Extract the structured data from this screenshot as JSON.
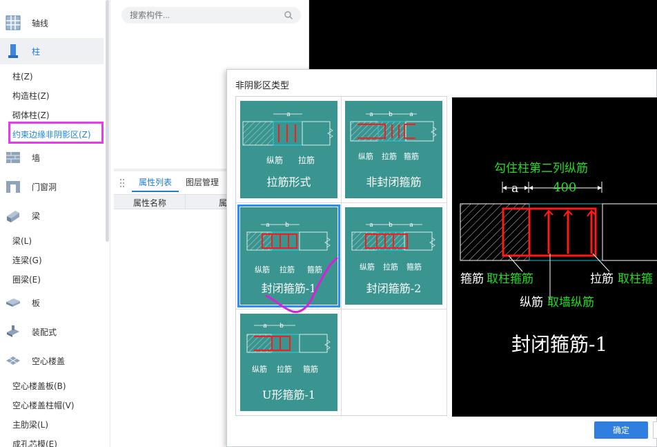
{
  "sidebar": {
    "categories": [
      {
        "label": "轴线",
        "icon": "grid-axis-icon"
      },
      {
        "label": "柱",
        "icon": "column-icon"
      },
      {
        "label": "墙",
        "icon": "wall-icon"
      },
      {
        "label": "门窗洞",
        "icon": "door-window-icon"
      },
      {
        "label": "梁",
        "icon": "beam-icon"
      },
      {
        "label": "板",
        "icon": "slab-icon"
      },
      {
        "label": "装配式",
        "icon": "prefab-icon"
      },
      {
        "label": "空心楼盖",
        "icon": "hollow-floor-icon"
      }
    ],
    "column_items": [
      "柱(Z)",
      "构造柱(Z)",
      "砌体柱(Z)",
      "约束边缘非阴影区(Z)"
    ],
    "beam_items": [
      "梁(L)",
      "连梁(G)",
      "圈梁(E)"
    ],
    "hollow_items": [
      "空心楼盖板(B)",
      "空心楼盖柱帽(V)",
      "主肋梁(L)",
      "成孔芯模(E)"
    ]
  },
  "search": {
    "placeholder": "搜索构件..."
  },
  "tabs": [
    "属性列表",
    "图层管理"
  ],
  "prop_table": {
    "headers": [
      "属性名称",
      "属"
    ]
  },
  "dialog": {
    "title": "非阴影区类型",
    "tiles": [
      {
        "name": "拉筋形式",
        "labels": [
          "纵筋",
          "拉筋"
        ],
        "dims": [
          "a"
        ]
      },
      {
        "name": "非封闭箍筋",
        "labels": [
          "纵筋",
          "拉筋",
          "箍筋"
        ],
        "dims": [
          "a",
          "b",
          "a"
        ]
      },
      {
        "name": "封闭箍筋-1",
        "labels": [
          "纵筋",
          "拉筋",
          "箍筋"
        ],
        "dims": [
          "a",
          "b"
        ]
      },
      {
        "name": "封闭箍筋-2",
        "labels": [
          "纵筋",
          "拉筋",
          "箍筋"
        ],
        "dims": [
          "a",
          "b",
          "a"
        ]
      },
      {
        "name": "U形箍筋-1",
        "labels": [
          "纵筋",
          "拉筋",
          "箍筋"
        ],
        "dims": [
          "a",
          "b"
        ]
      }
    ],
    "selected": "封闭箍筋-1",
    "preview": {
      "top_note": "勾住柱第二列纵筋",
      "dim_a": "a",
      "dim_value": "400",
      "label_hoop": "箍筋",
      "label_hoop_value": "取柱箍筋",
      "label_tie": "拉筋",
      "label_tie_value": "取柱箍",
      "label_long": "纵筋",
      "label_long_value": "取墙纵筋",
      "title": "封闭箍筋-1"
    },
    "ok_label": "确定"
  },
  "colors": {
    "accent": "#1e7bd6",
    "tile_bg": "#3a9590",
    "highlight": "#e83ae8",
    "rebar": "#ff1a1a",
    "cad_green": "#22dd22",
    "cad_cyan": "#25b9c6"
  }
}
